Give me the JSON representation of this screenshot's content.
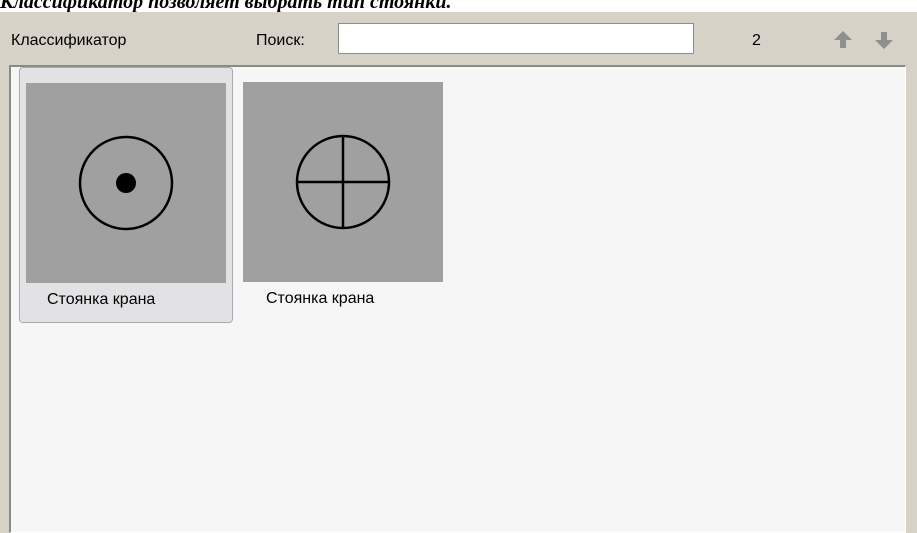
{
  "caption": "Классификатор позволяет выбрать тип стоянки.",
  "toolbar": {
    "title": "Классификатор",
    "search_label": "Поиск:",
    "search_value": "",
    "count": "2",
    "up_icon": "arrow-up-icon",
    "down_icon": "arrow-down-icon"
  },
  "items": [
    {
      "label": "Стоянка крана",
      "icon": "circle-dot-icon",
      "selected": true
    },
    {
      "label": "Стоянка крана",
      "icon": "circle-cross-icon",
      "selected": false
    }
  ],
  "colors": {
    "panel_bg": "#d7d2c8",
    "list_bg": "#f6f6f6",
    "thumb_bg": "#a0a0a0",
    "arrow": "#8f8f8f"
  }
}
